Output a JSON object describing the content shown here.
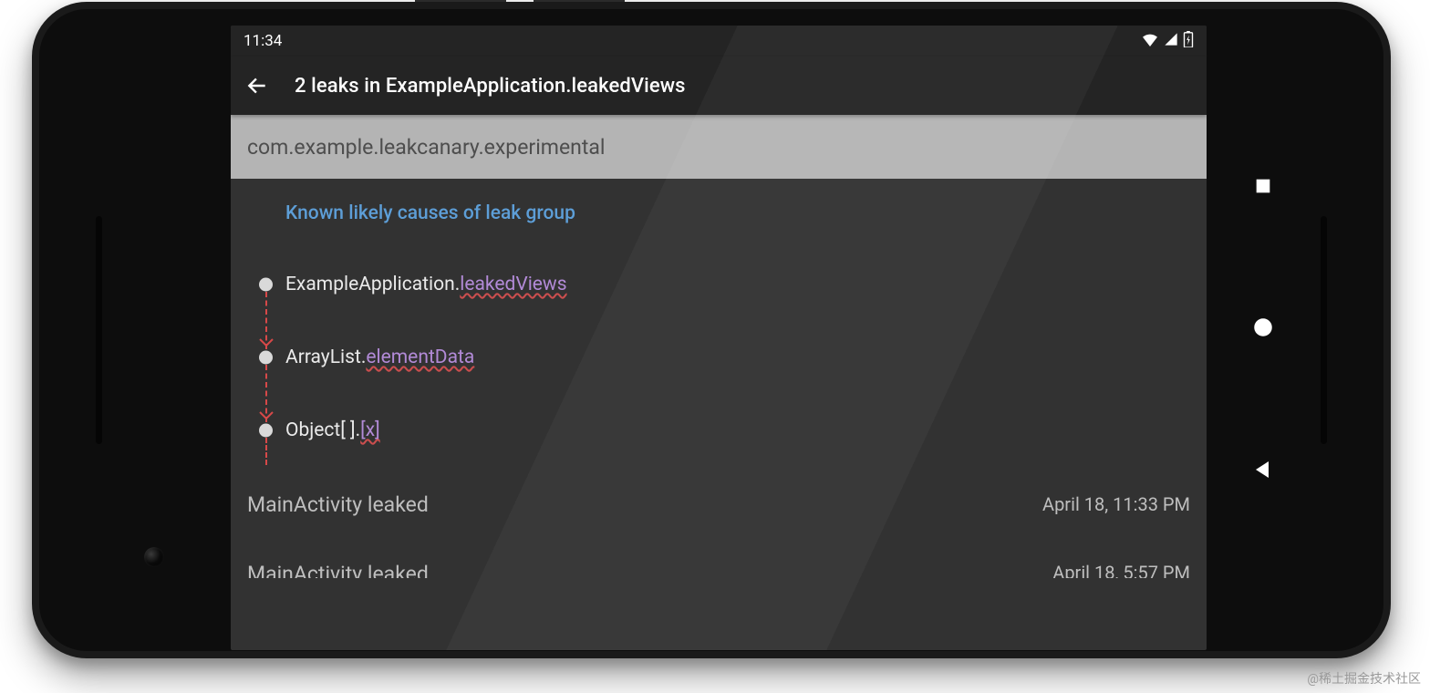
{
  "status": {
    "time": "11:34"
  },
  "appbar": {
    "title": "2 leaks in ExampleApplication.leakedViews"
  },
  "package_header": "com.example.leakcanary.experimental",
  "trace": {
    "header": "Known likely causes of leak group",
    "rows": [
      {
        "class": "ExampleApplication.",
        "field": "leakedViews"
      },
      {
        "class": "ArrayList.",
        "field": "elementData"
      },
      {
        "class": "Object[ ].",
        "field": "[x]"
      }
    ]
  },
  "leaks": [
    {
      "title": "MainActivity leaked",
      "time": "April 18, 11:33 PM"
    },
    {
      "title": "MainActivity leaked",
      "time": "April 18, 5:57 PM"
    }
  ],
  "watermark": "@稀土掘金技术社区"
}
